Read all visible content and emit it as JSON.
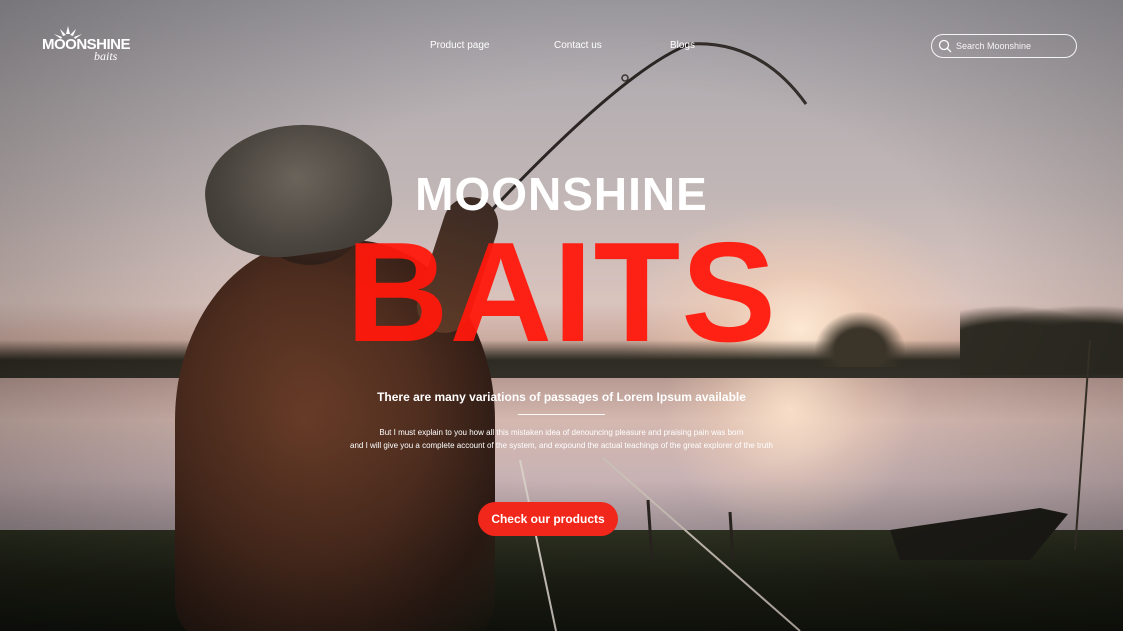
{
  "logo": {
    "brand": "MOONSHINE",
    "sub": "baits"
  },
  "nav": {
    "items": [
      {
        "label": "Product page"
      },
      {
        "label": "Contact us"
      },
      {
        "label": "Blogs"
      }
    ]
  },
  "search": {
    "placeholder": "Search Moonshine"
  },
  "hero": {
    "title_top": "MOONSHINE",
    "title_main": "BAITS",
    "tagline": "There are many variations of passages of Lorem Ipsum available",
    "desc_line1": "But I must explain to you how all this mistaken idea of denouncing pleasure and praising pain was born",
    "desc_line2": "and I will give you a complete account of the system, and expound the actual teachings of the great explorer of the truth",
    "cta": "Check our products"
  },
  "colors": {
    "accent": "#f2271b",
    "text": "#ffffff"
  },
  "icons": {
    "search": "search-icon",
    "logo": "sunburst-logo-icon"
  }
}
